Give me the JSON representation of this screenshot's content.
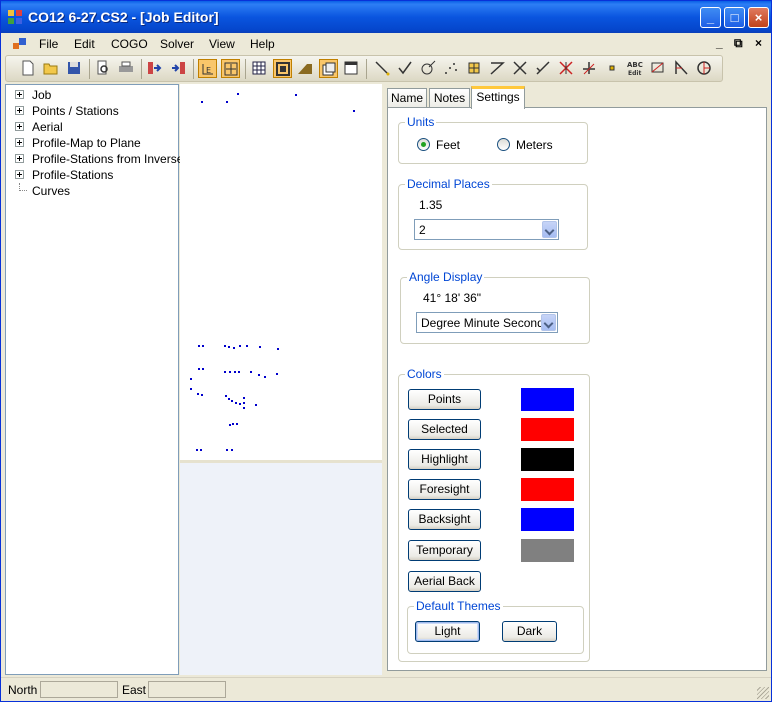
{
  "window": {
    "title": "CO12 6-27.CS2 - [Job Editor]",
    "controls": {
      "minimize": "_",
      "maximize": "□",
      "close": "×"
    }
  },
  "menubar": {
    "items": [
      "File",
      "Edit",
      "COGO",
      "Solver",
      "View",
      "Help"
    ],
    "mdi_controls": {
      "minimize": "_",
      "restore": "⧉",
      "close": "×"
    }
  },
  "toolbar": {
    "buttons": [
      {
        "icon": "new-file-icon"
      },
      {
        "icon": "open-folder-icon"
      },
      {
        "icon": "save-icon"
      },
      {
        "icon": "print-preview-icon"
      },
      {
        "icon": "print-icon"
      },
      {
        "icon": "export-icon"
      },
      {
        "icon": "import-icon"
      },
      {
        "icon": "fit-to-page-icon",
        "active": true
      },
      {
        "icon": "zoom-extents-icon",
        "active": true
      },
      {
        "icon": "grid-view-icon"
      },
      {
        "icon": "frame-icon",
        "active": true
      },
      {
        "icon": "profile-icon"
      },
      {
        "icon": "layers-icon",
        "active": true
      },
      {
        "icon": "window-icon"
      },
      {
        "icon": "line-icon"
      },
      {
        "icon": "checkmark-icon"
      },
      {
        "icon": "curve-tool-icon"
      },
      {
        "icon": "scatter-points-icon"
      },
      {
        "icon": "grid-points-icon"
      },
      {
        "icon": "angle-icon"
      },
      {
        "icon": "intersect-icon"
      },
      {
        "icon": "offset-icon"
      },
      {
        "icon": "cross-icon"
      },
      {
        "icon": "perpendicular-icon"
      },
      {
        "icon": "point-icon"
      },
      {
        "icon": "abc-edit-icon"
      },
      {
        "icon": "measure-icon"
      },
      {
        "icon": "inverse-icon"
      },
      {
        "icon": "arc-icon"
      }
    ],
    "abc_edit_text": "ABC Edit"
  },
  "tree": {
    "items": [
      {
        "label": "Job",
        "expandable": true
      },
      {
        "label": "Points / Stations",
        "expandable": true
      },
      {
        "label": "Aerial",
        "expandable": true
      },
      {
        "label": "Profile-Map to Plane",
        "expandable": true
      },
      {
        "label": "Profile-Stations from Inverse",
        "expandable": true
      },
      {
        "label": "Profile-Stations",
        "expandable": true
      },
      {
        "label": "Curves",
        "expandable": false
      }
    ]
  },
  "tabs": [
    "Name",
    "Notes",
    "Settings"
  ],
  "settings": {
    "units": {
      "title": "Units",
      "options": [
        "Feet",
        "Meters"
      ],
      "selected": "Feet"
    },
    "decimal_places": {
      "title": "Decimal Places",
      "sample": "1.35",
      "value": "2"
    },
    "angle_display": {
      "title": "Angle Display",
      "sample": "41° 18' 36\"",
      "value": "Degree Minute Second"
    },
    "colors": {
      "title": "Colors",
      "items": [
        {
          "label": "Points",
          "color": "#0000ff"
        },
        {
          "label": "Selected",
          "color": "#ff0000"
        },
        {
          "label": "Highlight",
          "color": "#000000"
        },
        {
          "label": "Foresight",
          "color": "#ff0000"
        },
        {
          "label": "Backsight",
          "color": "#0000ff"
        },
        {
          "label": "Temporary",
          "color": "#808080"
        },
        {
          "label": "Aerial Back",
          "color": null
        }
      ],
      "themes": {
        "title": "Default Themes",
        "light": "Light",
        "dark": "Dark"
      }
    }
  },
  "statusbar": {
    "north_label": "North",
    "north_value": "",
    "east_label": "East",
    "east_value": ""
  }
}
